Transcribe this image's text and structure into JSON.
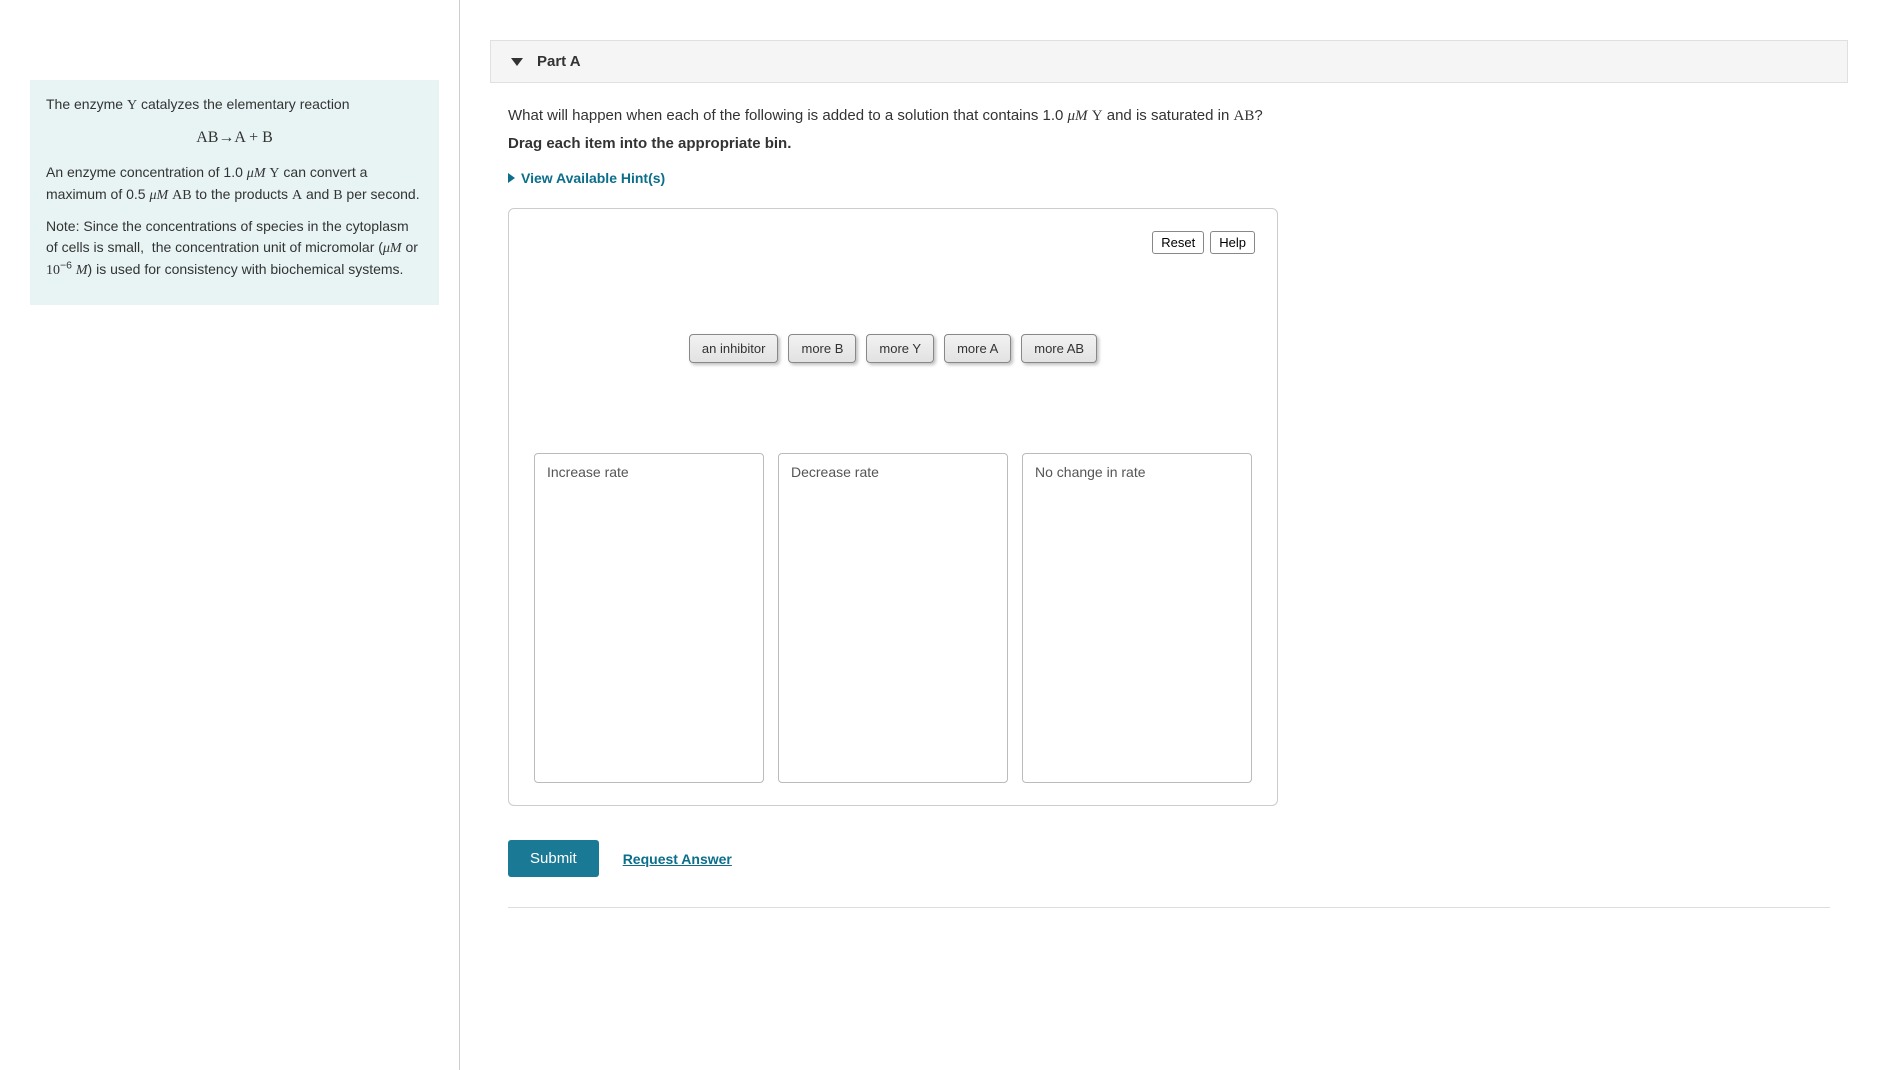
{
  "info_box": {
    "line1_pre": "The enzyme ",
    "line1_var": "Y",
    "line1_post": " catalyzes the elementary reaction",
    "reaction": "AB→A + B",
    "para2": "An enzyme concentration of 1.0 μM Y can convert a maximum of 0.5 μM AB to the products A and B per second.",
    "note": "Note: Since the concentrations of species in the cytoplasm of cells is small,  the concentration unit of micromolar (μM or 10⁻⁶ M) is used for consistency with biochemical systems."
  },
  "part": {
    "header": "Part A",
    "question": "What will happen when each of the following is added to a solution that contains 1.0 μM Y and is saturated in AB?",
    "instruction": "Drag each item into the appropriate bin.",
    "hints_label": "View Available Hint(s)"
  },
  "activity": {
    "reset_label": "Reset",
    "help_label": "Help",
    "items": [
      "an inhibitor",
      "more B",
      "more Y",
      "more A",
      "more AB"
    ],
    "bins": [
      "Increase rate",
      "Decrease rate",
      "No change in rate"
    ]
  },
  "footer": {
    "submit_label": "Submit",
    "request_label": "Request Answer"
  }
}
